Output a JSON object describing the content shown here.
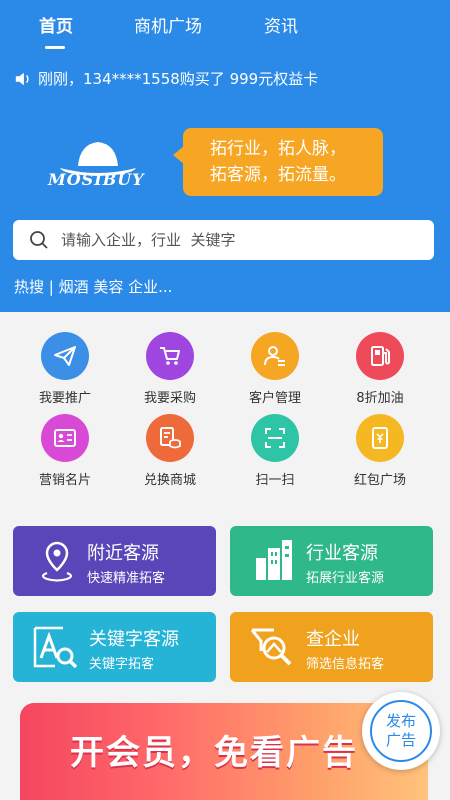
{
  "tabs": [
    {
      "label": "首页",
      "active": true
    },
    {
      "label": "商机广场",
      "active": false
    },
    {
      "label": "资讯",
      "active": false
    }
  ],
  "ticker": {
    "text": "刚刚，134****1558购买了 999元权益卡"
  },
  "logo": {
    "text": "MOSIBUY"
  },
  "slogan": {
    "line1": "拓行业，拓人脉，",
    "line2": "拓客源，拓流量。"
  },
  "search": {
    "placeholder": "请输入企业，行业  关键字"
  },
  "hot": {
    "text": "热搜 | 烟酒 美容 企业..."
  },
  "grid": [
    {
      "label": "我要推广",
      "icon": "paper-plane-icon",
      "color": "#3b8fe6"
    },
    {
      "label": "我要采购",
      "icon": "shopping-cart-icon",
      "color": "#a046e0"
    },
    {
      "label": "客户管理",
      "icon": "customer-icon",
      "color": "#f5a623"
    },
    {
      "label": "8折加油",
      "icon": "fuel-pump-icon",
      "color": "#ef4a5a"
    },
    {
      "label": "营销名片",
      "icon": "business-card-icon",
      "color": "#d84ad6"
    },
    {
      "label": "兑换商城",
      "icon": "coins-icon",
      "color": "#ef6a3a"
    },
    {
      "label": "扫一扫",
      "icon": "scan-icon",
      "color": "#2ec4a6"
    },
    {
      "label": "红包广场",
      "icon": "red-packet-icon",
      "color": "#f5b823"
    }
  ],
  "cards": [
    {
      "title": "附近客源",
      "subtitle": "快速精准拓客",
      "color": "#5a46b8",
      "icon": "location-pin-icon"
    },
    {
      "title": "行业客源",
      "subtitle": "拓展行业客源",
      "color": "#2fb88a",
      "icon": "buildings-icon"
    },
    {
      "title": "关键字客源",
      "subtitle": "关键字拓客",
      "color": "#25b4d6",
      "icon": "keyword-search-icon"
    },
    {
      "title": "查企业",
      "subtitle": "筛选信息拓客",
      "color": "#f0a21e",
      "icon": "filter-search-icon"
    }
  ],
  "banner": {
    "text": "开会员，免看广告"
  },
  "fab": {
    "line1": "发布",
    "line2": "广告"
  }
}
